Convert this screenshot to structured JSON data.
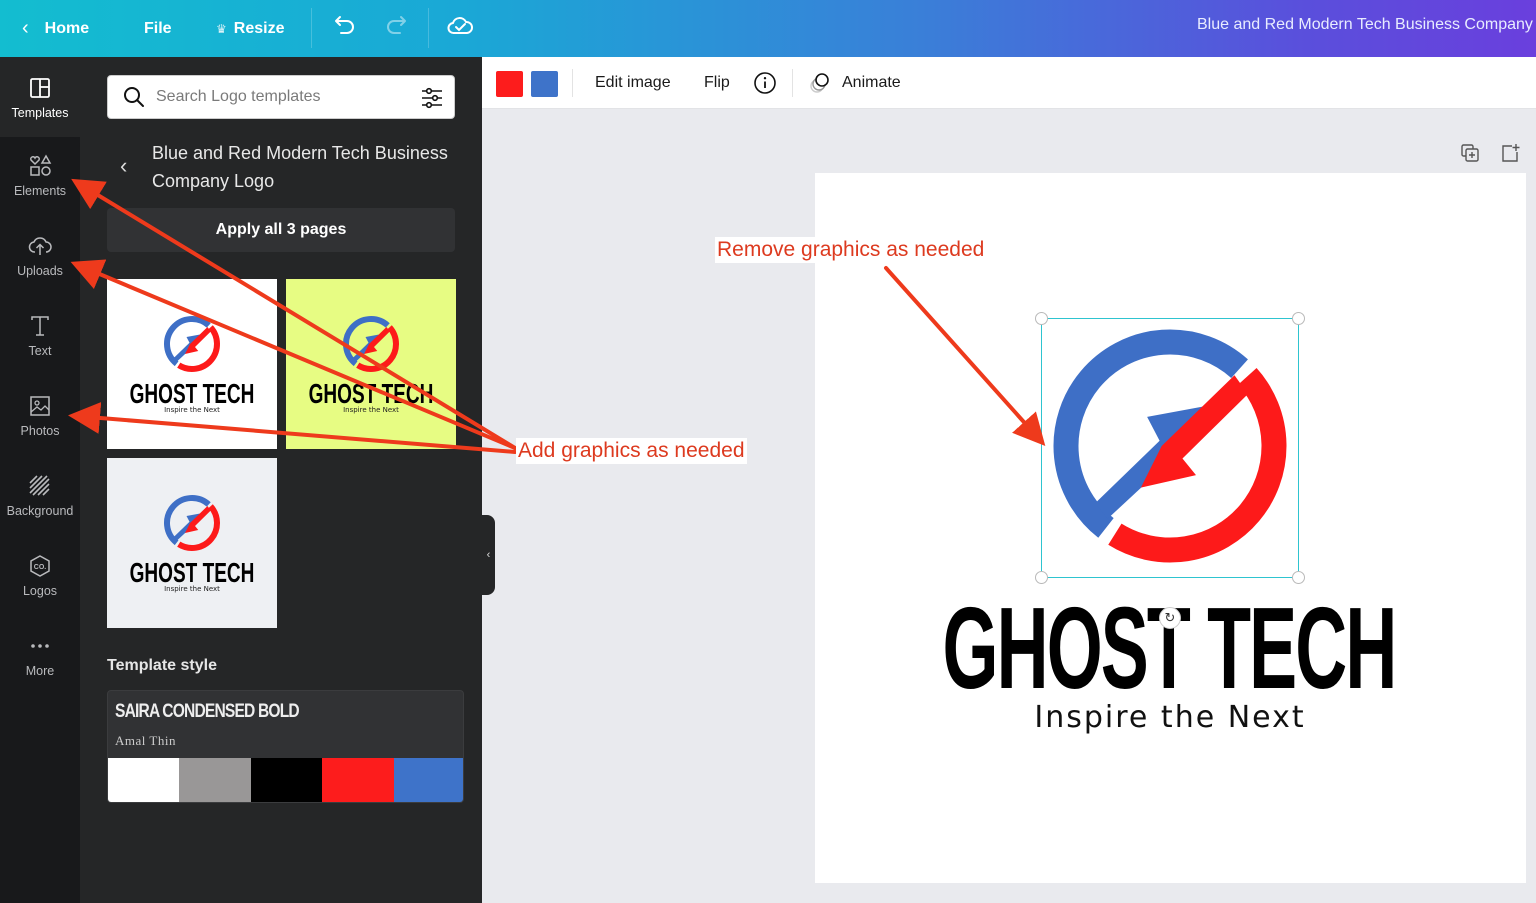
{
  "topbar": {
    "home_label": "Home",
    "file_label": "File",
    "resize_label": "Resize",
    "document_title": "Blue and Red Modern Tech Business Company Logo"
  },
  "rail": {
    "items": [
      {
        "label": "Templates",
        "icon": "templates-icon"
      },
      {
        "label": "Elements",
        "icon": "elements-icon"
      },
      {
        "label": "Uploads",
        "icon": "upload-cloud-icon"
      },
      {
        "label": "Text",
        "icon": "text-icon"
      },
      {
        "label": "Photos",
        "icon": "photo-icon"
      },
      {
        "label": "Background",
        "icon": "background-icon"
      },
      {
        "label": "Logos",
        "icon": "logos-icon"
      },
      {
        "label": "More",
        "icon": "more-icon"
      }
    ]
  },
  "panel": {
    "search_placeholder": "Search Logo templates",
    "template_title": "Blue and Red Modern Tech Business Company Logo",
    "apply_label": "Apply all 3 pages",
    "thumbnails": [
      {
        "bg": "#ffffff",
        "brand": "GHOST TECH",
        "tagline": "Inspire the Next"
      },
      {
        "bg": "#e7fc83",
        "brand": "GHOST TECH",
        "tagline": "Inspire the Next"
      },
      {
        "bg": "#eef0f3",
        "brand": "GHOST TECH",
        "tagline": "Inspire the Next"
      }
    ],
    "style_heading": "Template style",
    "style_font_primary": "SAIRA CONDENSED BOLD",
    "style_font_secondary": "Amal Thin",
    "style_palette": [
      "#ffffff",
      "#999797",
      "#000000",
      "#fd1c1c",
      "#3e73c9"
    ]
  },
  "context_toolbar": {
    "colors": [
      "#fd1c1c",
      "#3e73c9"
    ],
    "edit_image_label": "Edit image",
    "flip_label": "Flip",
    "animate_label": "Animate"
  },
  "canvas": {
    "brand": "GHOST TECH",
    "tagline": "Inspire the Next",
    "logo_colors": {
      "blue": "#3e6fc6",
      "red": "#fd1a1a"
    }
  },
  "annotations": {
    "remove_label": "Remove graphics as needed",
    "add_label": "Add graphics as needed",
    "arrow_color": "#ee3a1c"
  }
}
